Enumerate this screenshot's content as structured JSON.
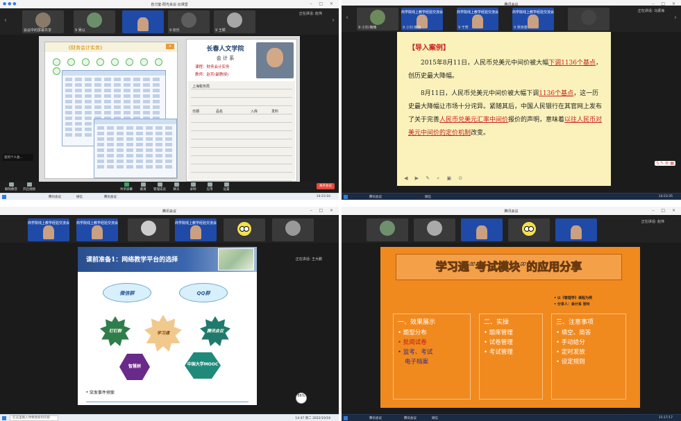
{
  "q1": {
    "window_title": "自习室-阳光会议-云课堂",
    "strip_tiles": [
      "会议中的屏幕共享",
      "9 吴以",
      "",
      "9 欢乐",
      "9 王颖",
      "",
      "正在讲话: 赵伟"
    ],
    "share": {
      "app_title": "《财务会计实务》",
      "school": "长春人文学院",
      "dept": "会 计 系",
      "course": "课程：财务会计实务",
      "teacher": "教师：赵芳(副教授)",
      "handwriting": [
        "上海税务局",
        "日期",
        "品名",
        "入库",
        "发料"
      ]
    },
    "self_view": "您的个人会...",
    "controls": [
      "解除静音",
      "开启视频",
      "共享屏幕",
      "邀请",
      "管理成员",
      "聊天",
      "录制",
      "应用",
      "设置"
    ],
    "end_button": "离开会议",
    "taskbar": {
      "apps": [
        "腾讯会议",
        "微信",
        "腾讯会议"
      ],
      "time": "14:23:16"
    }
  },
  "q2": {
    "window_title": "腾讯会议",
    "strip_tiles": [
      "9 小刘·楠楠",
      "9 于贺",
      "9 吴晓春",
      "正在讲话: 马振海"
    ],
    "banner": "商学院线上教学经验交流会",
    "slide": {
      "heading": "【导入案例】",
      "p1_a": "2015年8月11日，人民币兑美元中间价被大幅",
      "p1_link": "下调1136个基点",
      "p1_b": "，创历史最大降幅。",
      "p2_a": "8月11日，人民币兑美元中间价被大幅下调",
      "p2_link1": "1136个基点",
      "p2_b": "，这一历史最大降幅让市场十分诧异。紧随其后，中国人民银行在其官网上发布了关于完善",
      "p2_link2": "人民币兑美元汇率中间价",
      "p2_c": "报价的声明，意味着",
      "p2_link3": "以往人民币对美元中间价的定价机制",
      "p2_d": "改变。"
    },
    "taskbar": {
      "apps": [
        "腾讯会议",
        "微信"
      ],
      "time": "14:23:35"
    }
  },
  "q3": {
    "window_title": "腾讯会议",
    "strip_tiles": [
      "商学院线上教学经验交流会",
      "商学院线上教学经验交流会",
      "",
      "商学院线上教学经验交流会",
      "",
      "",
      "正在讲话: 王大鹏"
    ],
    "slide": {
      "title": "课前准备1：网络教学平台的选择",
      "clouds": [
        "微信群",
        "QQ群"
      ],
      "stars": [
        "钉钉群",
        "学习通",
        "腾讯会议"
      ],
      "hexes": [
        "智慧树",
        "中国大学MOOC"
      ],
      "footnote": "* 突发事件预案"
    },
    "zoom": "86%",
    "taskbar": {
      "search": "在这里输入你要搜索的内容",
      "time": "14:47 周二 2022/10/18"
    }
  },
  "q4": {
    "window_title": "腾讯会议",
    "strip_tiles": [
      "",
      "",
      "",
      "",
      "",
      "",
      "",
      "正在讲话: 赵伟"
    ],
    "slide": {
      "title": "学习通“考试模块”的应用分享",
      "bullets": [
        "• 以《管理学》课程为例",
        "• 分享人：会计系 张玲"
      ],
      "col1": {
        "head": "一、效果展示",
        "items": [
          "• 题型分布",
          "• 批阅试卷",
          "• 监考、考试",
          "电子档案"
        ]
      },
      "col2": {
        "head": "二、实操",
        "items": [
          "• 题库管理",
          "• 试卷管理",
          "• 考试管理"
        ]
      },
      "col3": {
        "head": "三、注意事项",
        "items": [
          "• 填空、简答",
          "• 手动给分",
          "• 定时发放",
          "• 设定规则"
        ]
      }
    },
    "taskbar": {
      "apps": [
        "腾讯会议",
        "腾讯会议",
        "微信"
      ],
      "time": "15:17:17"
    }
  },
  "colors": {
    "accent_red": "#c8201c",
    "meeting_dark": "#1b1b1b",
    "slide_orange": "#f08a1f"
  }
}
